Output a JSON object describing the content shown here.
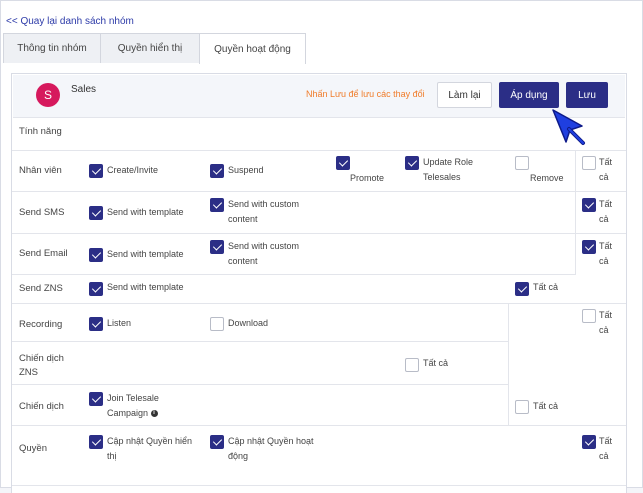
{
  "back_link": "<< Quay lại danh sách nhóm",
  "tabs": [
    {
      "label": "Thông tin nhóm",
      "active": false
    },
    {
      "label": "Quyền hiển thị",
      "active": false
    },
    {
      "label": "Quyền hoạt động",
      "active": true
    }
  ],
  "group": {
    "avatar_letter": "S",
    "name": "Sales",
    "avatar_color": "#d6195d"
  },
  "header": {
    "hint": "Nhấn Lưu để lưu các thay đổi",
    "reset_label": "Làm lại",
    "apply_label": "Áp dụng",
    "save_label": "Lưu"
  },
  "colors": {
    "primary": "#2b2e86",
    "hint": "#f07c2a"
  },
  "section_title": "Tính năng",
  "rows": [
    {
      "label": "Nhân viên",
      "options": [
        {
          "label": "Create/Invite",
          "checked": true
        },
        {
          "label": "Suspend",
          "checked": true
        },
        {
          "label": "Promote",
          "checked": true
        },
        {
          "label": "Update Role Telesales",
          "checked": true
        },
        {
          "label": "Remove",
          "checked": false
        }
      ],
      "all": {
        "label": "Tất cả",
        "checked": false
      }
    },
    {
      "label": "Send SMS",
      "options": [
        {
          "label": "Send with template",
          "checked": true
        },
        {
          "label": "Send with custom content",
          "checked": true
        }
      ],
      "all": {
        "label": "Tất cả",
        "checked": true
      }
    },
    {
      "label": "Send Email",
      "options": [
        {
          "label": "Send with template",
          "checked": true
        },
        {
          "label": "Send with custom content",
          "checked": true
        }
      ],
      "all": {
        "label": "Tất cả",
        "checked": true
      }
    },
    {
      "label": "Send ZNS",
      "options": [
        {
          "label": "Send with template",
          "checked": true
        }
      ],
      "all": {
        "label": "Tất cả",
        "checked": true
      }
    },
    {
      "label": "Recording",
      "options": [
        {
          "label": "Listen",
          "checked": true
        },
        {
          "label": "Download",
          "checked": false
        }
      ],
      "all": {
        "label": "Tất cả",
        "checked": false
      }
    },
    {
      "label": "Chiến dịch ZNS",
      "options": [],
      "all": {
        "label": "Tất cả",
        "checked": false
      }
    },
    {
      "label": "Chiến dịch",
      "options": [
        {
          "label": "Join Telesale Campaign",
          "checked": true
        }
      ],
      "all": {
        "label": "Tất cả",
        "checked": false
      }
    },
    {
      "label": "Quyền",
      "options": [
        {
          "label": "Cập nhật Quyền hiển thị",
          "checked": true
        },
        {
          "label": "Cập nhật Quyền hoạt động",
          "checked": true
        }
      ],
      "all": {
        "label": "Tất cả",
        "checked": true
      }
    }
  ]
}
